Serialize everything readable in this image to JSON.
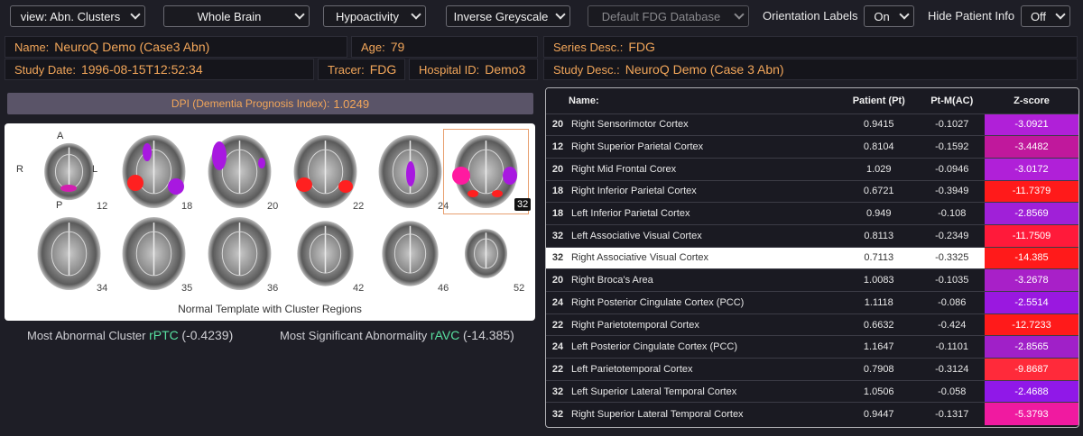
{
  "toolbar": {
    "view_select": "view: Abn. Clusters",
    "region_select": "Whole Brain",
    "mode_select": "Hypoactivity",
    "colormap_select": "Inverse Greyscale",
    "database_select": "Default FDG Database",
    "orientation_label": "Orientation Labels",
    "orientation_value": "On",
    "hide_info_label": "Hide Patient Info",
    "hide_info_value": "Off"
  },
  "patient": {
    "name_label": "Name:",
    "name": "NeuroQ Demo (Case3 Abn)",
    "age_label": "Age:",
    "age": "79",
    "series_label": "Series Desc.:",
    "series": "FDG",
    "date_label": "Study Date:",
    "date": "1996-08-15T12:52:34",
    "tracer_label": "Tracer:",
    "tracer": "FDG",
    "hospital_label": "Hospital ID:",
    "hospital": "Demo3",
    "study_label": "Study Desc.:",
    "study": "NeuroQ Demo (Case 3 Abn)"
  },
  "dpi": {
    "label": "DPI (Dementia Prognosis Index):",
    "value": "1.0249"
  },
  "viewer": {
    "caption": "Normal Template with Cluster Regions",
    "orient": {
      "a": "A",
      "p": "P",
      "r": "R",
      "l": "L"
    },
    "slices": [
      "12",
      "18",
      "20",
      "22",
      "24",
      "32",
      "34",
      "35",
      "36",
      "42",
      "46",
      "52"
    ],
    "selected_slice": "32"
  },
  "summary": {
    "cluster_label": "Most Abnormal Cluster",
    "cluster_abbr": "rPTC",
    "cluster_value": "(-0.4239)",
    "abnorm_label": "Most Significant Abnormality",
    "abnorm_abbr": "rAVC",
    "abnorm_value": "(-14.385)"
  },
  "table": {
    "headers": [
      "Name:",
      "Patient (Pt)",
      "Pt-M(AC)",
      "Z-score"
    ],
    "rows": [
      {
        "cl": "20",
        "name": "Right Sensorimotor Cortex",
        "pt": "0.9415",
        "ptm": "-0.1027",
        "z": "-3.0921",
        "color": "#b020d8"
      },
      {
        "cl": "12",
        "name": "Right Superior Parietal Cortex",
        "pt": "0.8104",
        "ptm": "-0.1592",
        "z": "-3.4482",
        "color": "#c0189c"
      },
      {
        "cl": "20",
        "name": "Right Mid Frontal Corex",
        "pt": "1.029",
        "ptm": "-0.0946",
        "z": "-3.0172",
        "color": "#b020d8"
      },
      {
        "cl": "18",
        "name": "Right Inferior Parietal Cortex",
        "pt": "0.6721",
        "ptm": "-0.3949",
        "z": "-11.7379",
        "color": "#ff1a1a"
      },
      {
        "cl": "18",
        "name": "Left Inferior Parietal Cortex",
        "pt": "0.949",
        "ptm": "-0.108",
        "z": "-2.8569",
        "color": "#a020d8"
      },
      {
        "cl": "32",
        "name": "Left Associative Visual Cortex",
        "pt": "0.8113",
        "ptm": "-0.2349",
        "z": "-11.7509",
        "color": "#ff1a3a"
      },
      {
        "cl": "32",
        "name": "Right Associative Visual Cortex",
        "pt": "0.7113",
        "ptm": "-0.3325",
        "z": "-14.385",
        "color": "#ff1a1a"
      },
      {
        "cl": "20",
        "name": "Right Broca's Area",
        "pt": "1.0083",
        "ptm": "-0.1035",
        "z": "-3.2678",
        "color": "#a820c8"
      },
      {
        "cl": "24",
        "name": "Right Posterior Cingulate Cortex (PCC)",
        "pt": "1.1118",
        "ptm": "-0.086",
        "z": "-2.5514",
        "color": "#9a18e0"
      },
      {
        "cl": "22",
        "name": "Right Parietotemporal Cortex",
        "pt": "0.6632",
        "ptm": "-0.424",
        "z": "-12.7233",
        "color": "#ff1a1a"
      },
      {
        "cl": "24",
        "name": "Left Posterior Cingulate Cortex (PCC)",
        "pt": "1.1647",
        "ptm": "-0.1101",
        "z": "-2.8565",
        "color": "#a020c8"
      },
      {
        "cl": "22",
        "name": "Left Parietotemporal Cortex",
        "pt": "0.7908",
        "ptm": "-0.3124",
        "z": "-9.8687",
        "color": "#ff2a3a"
      },
      {
        "cl": "32",
        "name": "Left Superior Lateral Temporal Cortex",
        "pt": "1.0506",
        "ptm": "-0.058",
        "z": "-2.4688",
        "color": "#9018e8"
      },
      {
        "cl": "32",
        "name": "Right Superior Lateral Temporal Cortex",
        "pt": "0.9447",
        "ptm": "-0.1317",
        "z": "-5.3793",
        "color": "#f01aa0"
      }
    ],
    "highlighted_row": 6
  }
}
